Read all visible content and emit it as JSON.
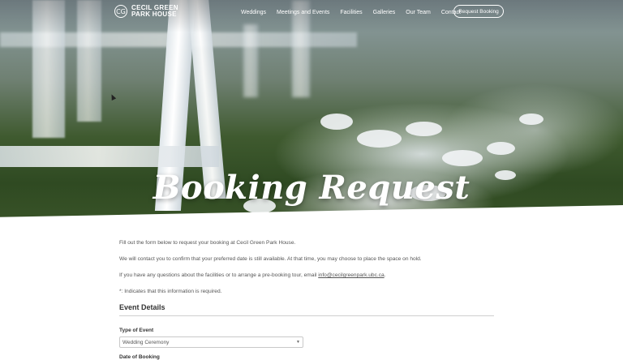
{
  "brand": {
    "logo_line1": "CECIL GREEN",
    "logo_line2": "PARK HOUSE",
    "logo_monogram": "CG"
  },
  "nav": {
    "items": [
      "Weddings",
      "Meetings and Events",
      "Facilities",
      "Galleries",
      "Our Team",
      "Contact"
    ],
    "cta": "Request Booking"
  },
  "hero": {
    "title": "Booking Request"
  },
  "intro": {
    "p1": "Fill out the form below to request your booking at Cecil Green Park House.",
    "p2": "We will contact you to confirm that your preferred date is still available. At that time, you may choose to place the space on hold.",
    "p3_prefix": "If you have any questions about the facilities or to arrange a pre-booking tour, email ",
    "p3_email": "info@cecilgreenpark.ubc.ca",
    "p3_suffix": ".",
    "p4": "*: Indicates that this information is required."
  },
  "form": {
    "section_title": "Event Details",
    "type_label": "Type of Event",
    "type_value": "Wedding Ceremony",
    "next_label": "Date of Booking"
  },
  "icons": {
    "caret": "chevron-down-icon",
    "logo": "crest-icon"
  }
}
